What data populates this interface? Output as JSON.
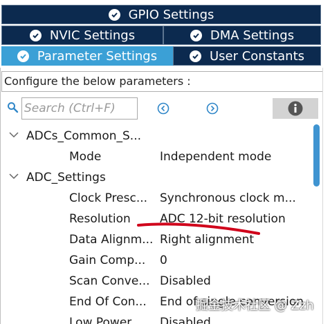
{
  "tabs": {
    "gpio": "GPIO Settings",
    "nvic": "NVIC Settings",
    "dma": "DMA Settings",
    "parameter": "Parameter Settings",
    "user_constants": "User Constants",
    "active": "parameter"
  },
  "configure_label": "Configure the below parameters :",
  "search": {
    "placeholder": "Search (Ctrl+F)"
  },
  "tree": {
    "groups": [
      {
        "label": "ADCs_Common_S...",
        "params": [
          {
            "name": "Mode",
            "value": "Independent mode"
          }
        ]
      },
      {
        "label": "ADC_Settings",
        "params": [
          {
            "name": "Clock Presc...",
            "value": "Synchronous clock m..."
          },
          {
            "name": "Resolution",
            "value": "ADC 12-bit resolution"
          },
          {
            "name": "Data Alignm...",
            "value": "Right alignment"
          },
          {
            "name": "Gain Comp...",
            "value": "0"
          },
          {
            "name": "Scan Conve...",
            "value": "Disabled"
          },
          {
            "name": "End Of Con...",
            "value": "End of single conversion"
          },
          {
            "name": "Low Power ...",
            "value": "Disabled"
          }
        ]
      }
    ]
  },
  "annotation": {
    "color": "#d0021b",
    "target": "Resolution"
  },
  "watermark": "掘金技术社区 @ Zzh",
  "colors": {
    "tab_bg": "#0c2a4f",
    "tab_active": "#3ba0d6",
    "scroll_thumb": "#3f94d1"
  }
}
